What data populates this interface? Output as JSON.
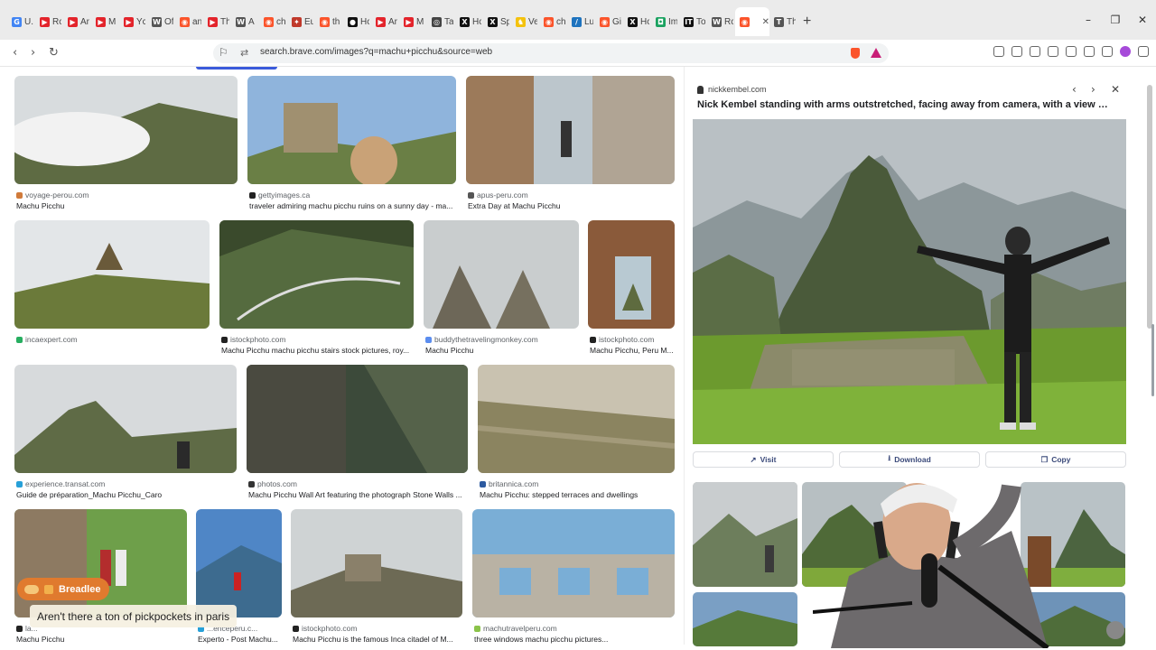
{
  "browser": {
    "tabs": [
      {
        "label": "U.",
        "color": "#4285f4",
        "glyph": "G"
      },
      {
        "label": "Rc",
        "color": "#e3242b",
        "glyph": "▶"
      },
      {
        "label": "Ar",
        "color": "#e3242b",
        "glyph": "▶"
      },
      {
        "label": "M",
        "color": "#e3242b",
        "glyph": "▶"
      },
      {
        "label": "Yc",
        "color": "#e3242b",
        "glyph": "▶"
      },
      {
        "label": "Of",
        "color": "#555555",
        "glyph": "W"
      },
      {
        "label": "an",
        "color": "#fb542b",
        "glyph": "◉"
      },
      {
        "label": "Th",
        "color": "#e3242b",
        "glyph": "▶"
      },
      {
        "label": "A",
        "color": "#555555",
        "glyph": "W"
      },
      {
        "label": "ch",
        "color": "#fb542b",
        "glyph": "◉"
      },
      {
        "label": "Eu",
        "color": "#c0392b",
        "glyph": "✦"
      },
      {
        "label": "th",
        "color": "#fb542b",
        "glyph": "◉"
      },
      {
        "label": "Hc",
        "color": "#111111",
        "glyph": "●"
      },
      {
        "label": "Ar",
        "color": "#e3242b",
        "glyph": "▶"
      },
      {
        "label": "M",
        "color": "#e3242b",
        "glyph": "▶"
      },
      {
        "label": "Ta",
        "color": "#444444",
        "glyph": "◎"
      },
      {
        "label": "Hc",
        "color": "#111111",
        "glyph": "X"
      },
      {
        "label": "Sp",
        "color": "#111111",
        "glyph": "X"
      },
      {
        "label": "Ve",
        "color": "#f4c20d",
        "glyph": "♞"
      },
      {
        "label": "ch",
        "color": "#fb542b",
        "glyph": "◉"
      },
      {
        "label": "Lu",
        "color": "#1e73be",
        "glyph": "/"
      },
      {
        "label": "Gi",
        "color": "#fb542b",
        "glyph": "◉"
      },
      {
        "label": "Hc",
        "color": "#111111",
        "glyph": "X"
      },
      {
        "label": "Im",
        "color": "#1aa260",
        "glyph": "◘"
      },
      {
        "label": "To",
        "color": "#111111",
        "glyph": "IT"
      },
      {
        "label": "Rc",
        "color": "#555555",
        "glyph": "W"
      },
      {
        "label": "",
        "color": "#fb542b",
        "glyph": "◉",
        "active": true
      },
      {
        "label": "Th",
        "color": "#555555",
        "glyph": "T"
      }
    ],
    "url": "search.brave.com/images?q=machu+picchu&source=web"
  },
  "results": [
    {
      "source": "voyage-perou.com",
      "caption": "Machu Picchu",
      "fav": "#d07a3a",
      "art": "clouds"
    },
    {
      "source": "gettyimages.ca",
      "caption": "traveler admiring machu picchu ruins on a sunny day - ma...",
      "fav": "#222222",
      "art": "hat"
    },
    {
      "source": "apus-peru.com",
      "caption": "Extra Day at Machu Picchu",
      "fav": "#555555",
      "art": "wall"
    },
    {
      "source": "incaexpert.com",
      "caption": "",
      "fav": "#27ae60",
      "art": "hut"
    },
    {
      "source": "istockphoto.com",
      "caption": "Machu Picchu machu picchu stairs stock pictures, roy...",
      "fav": "#222222",
      "art": "valley"
    },
    {
      "source": "buddythetravelingmonkey.com",
      "caption": "Machu Picchu",
      "fav": "#5b8def",
      "art": "ruins"
    },
    {
      "source": "istockphoto.com",
      "caption": "Machu Picchu, Peru M...",
      "fav": "#222222",
      "art": "window"
    },
    {
      "source": "experience.transat.com",
      "caption": "Guide de préparation_Machu Picchu_Caro",
      "fav": "#27a0d8",
      "art": "fog"
    },
    {
      "source": "photos.com",
      "caption": "Machu Picchu Wall Art featuring the photograph Stone Walls ...",
      "fav": "#333333",
      "art": "stone"
    },
    {
      "source": "britannica.com",
      "caption": "Machu Picchu: stepped terraces and dwellings",
      "fav": "#2d5aa0",
      "art": "terraces"
    },
    {
      "source": "la...",
      "caption": "Machu Picchu",
      "fav": "#222222",
      "art": "couple"
    },
    {
      "source": "...enceperu.c...",
      "caption": "Experto - Post Machu...",
      "fav": "#27a0d8",
      "art": "blue"
    },
    {
      "source": "istockphoto.com",
      "caption": "Machu Picchu is the famous Inca citadel of M...",
      "fav": "#222222",
      "art": "mist"
    },
    {
      "source": "machutravelperu.com",
      "caption": "three windows machu picchu pictures...",
      "fav": "#8bc34a",
      "art": "windows"
    }
  ],
  "detail": {
    "source": "nickkembel.com",
    "title": "Nick Kembel standing with arms outstretched, facing away from camera, with a view of...",
    "visit_label": "Visit",
    "download_label": "Download",
    "copy_label": "Copy"
  },
  "overlay": {
    "user": "Breadlee",
    "message": "Aren't there a ton of pickpockets in paris"
  }
}
